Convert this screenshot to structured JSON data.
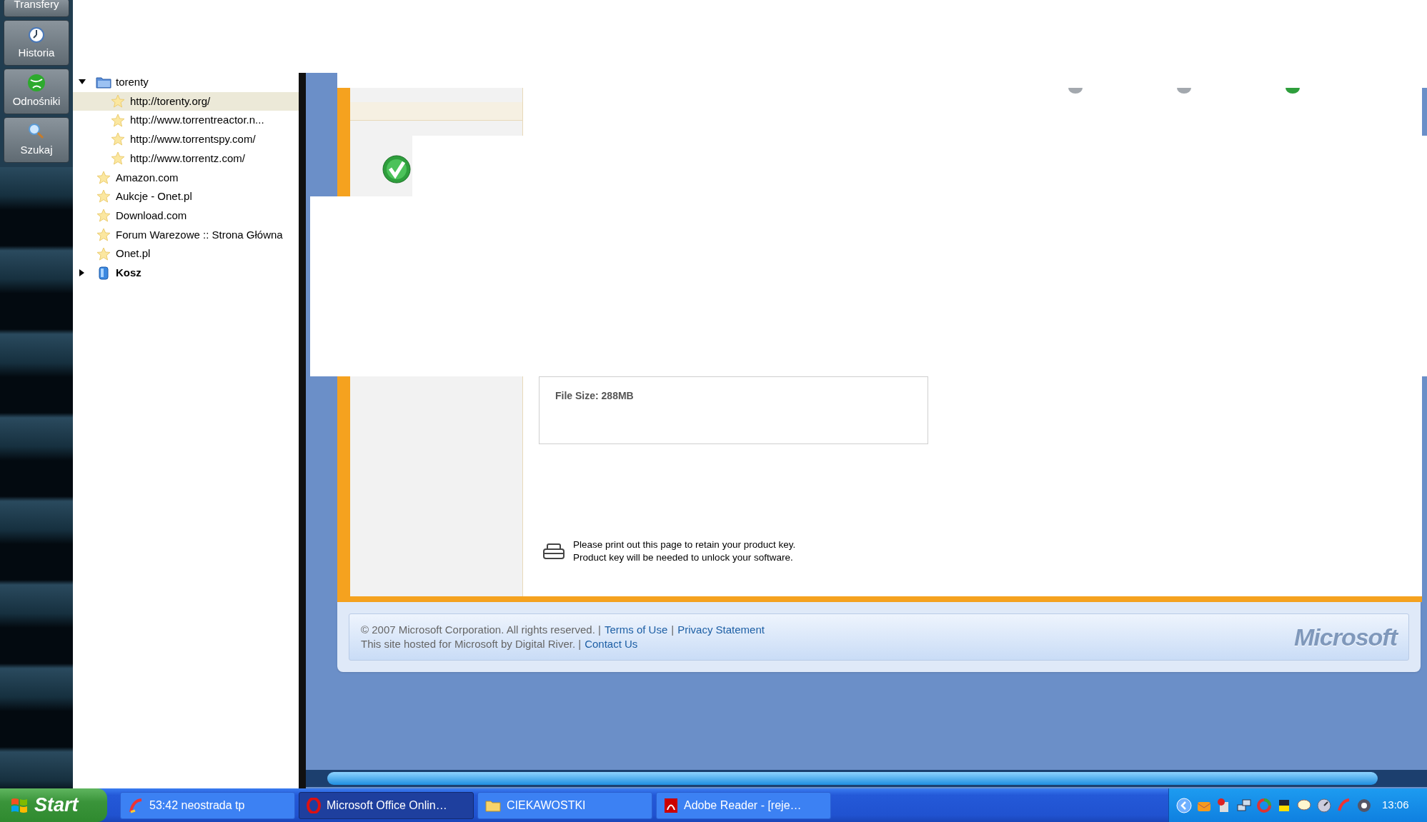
{
  "sidebar": {
    "buttons": [
      {
        "label": "Transfery",
        "kind": "transfers"
      },
      {
        "label": "Historia",
        "kind": "history"
      },
      {
        "label": "Odnośniki",
        "kind": "links"
      },
      {
        "label": "Szukaj",
        "kind": "search"
      }
    ]
  },
  "tree": [
    {
      "label": "torenty",
      "kind": "folder",
      "expanded": true,
      "selected": false,
      "children": [
        {
          "label": "http://torenty.org/",
          "kind": "bookmark",
          "selected": true
        },
        {
          "label": "http://www.torrentreactor.n...",
          "kind": "bookmark",
          "selected": false
        },
        {
          "label": "http://www.torrentspy.com/",
          "kind": "bookmark",
          "selected": false
        },
        {
          "label": "http://www.torrentz.com/",
          "kind": "bookmark",
          "selected": false
        }
      ]
    },
    {
      "label": "Amazon.com",
      "kind": "bookmark",
      "selected": false
    },
    {
      "label": "Aukcje - Onet.pl",
      "kind": "bookmark",
      "selected": false
    },
    {
      "label": "Download.com",
      "kind": "bookmark",
      "selected": false
    },
    {
      "label": "Forum Warezowe :: Strona Główna",
      "kind": "bookmark",
      "selected": false
    },
    {
      "label": "Onet.pl",
      "kind": "bookmark",
      "selected": false
    },
    {
      "label": "Kosz",
      "kind": "trash",
      "expanded": false,
      "selected": false
    }
  ],
  "page": {
    "steps": [
      {
        "completed": false
      },
      {
        "completed": false
      },
      {
        "completed": true
      }
    ],
    "file_size": "File Size: 288MB",
    "print_note": [
      "Please print out this page to retain your product key.",
      "Product key will be needed to unlock your software."
    ],
    "footer": {
      "lines": [
        [
          {
            "kind": "text",
            "text": "© 2007 Microsoft Corporation. All rights reserved. |"
          },
          {
            "kind": "link",
            "text": "Terms of Use"
          },
          {
            "kind": "text",
            "text": "|"
          },
          {
            "kind": "link",
            "text": "Privacy Statement"
          }
        ],
        [
          {
            "kind": "text",
            "text": "This site hosted for Microsoft by Digital River. |"
          },
          {
            "kind": "link",
            "text": "Contact Us"
          }
        ]
      ],
      "logo": "Microsoft"
    }
  },
  "taskbar": {
    "start": "Start",
    "tasks": [
      {
        "label": "53:42 neostrada tp",
        "kind": "dialer",
        "selected": false
      },
      {
        "label": "Microsoft Office Onlin…",
        "kind": "browser",
        "selected": true
      },
      {
        "label": "CIEKAWOSTKI",
        "kind": "folder",
        "selected": false
      },
      {
        "label": "Adobe Reader - [reje…",
        "kind": "pdf",
        "selected": false
      }
    ],
    "clock": "13:06"
  }
}
